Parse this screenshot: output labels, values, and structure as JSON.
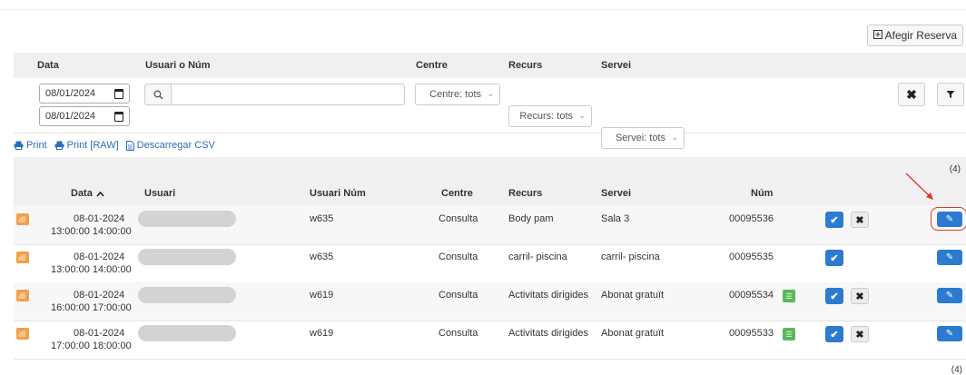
{
  "toolbar": {
    "add_label": "Afegir Reserva"
  },
  "filters": {
    "headers": {
      "data": "Data",
      "user": "Usuari o Núm",
      "centre": "Centre",
      "recurs": "Recurs",
      "servei": "Servei"
    },
    "date_from": "08/01/2024",
    "date_to": "08/01/2024",
    "search_value": "",
    "centre_select": "Centre: tots",
    "recurs_select": "Recurs: tots",
    "servei_select": "Servei: tots"
  },
  "export_links": {
    "print": "Print",
    "print_raw": "Print [RAW]",
    "csv": "Descarregar CSV"
  },
  "count_label": "(4)",
  "table": {
    "columns": {
      "data": "Data",
      "usuari": "Usuari",
      "usuari_num": "Usuari Núm",
      "centre": "Centre",
      "recurs": "Recurs",
      "servei": "Servei",
      "num": "Núm"
    },
    "sort_indicator": "chevron-up-icon",
    "rows": [
      {
        "date": "08-01-2024",
        "time": "13:00:00 14:00:00",
        "usuari_num": "w635",
        "centre": "Consulta",
        "recurs": "Body pam",
        "servei": "Sala 3",
        "num": "00095536",
        "badge": false,
        "reject": true
      },
      {
        "date": "08-01-2024",
        "time": "13:00:00 14:00:00",
        "usuari_num": "w635",
        "centre": "Consulta",
        "recurs": "carril- piscina",
        "servei": "carril- piscina",
        "num": "00095535",
        "badge": false,
        "reject": false
      },
      {
        "date": "08-01-2024",
        "time": "16:00:00 17:00:00",
        "usuari_num": "w619",
        "centre": "Consulta",
        "recurs": "Activitats dirigides",
        "servei": "Abonat gratuït",
        "num": "00095534",
        "badge": true,
        "reject": true
      },
      {
        "date": "08-01-2024",
        "time": "17:00:00 18:00:00",
        "usuari_num": "w619",
        "centre": "Consulta",
        "recurs": "Activitats dirigides",
        "servei": "Abonat gratuït",
        "num": "00095533",
        "badge": true,
        "reject": true
      }
    ]
  },
  "footer_count": "(4)",
  "colors": {
    "primary": "#2b7bd0",
    "accent_orange": "#f0a04e",
    "success": "#5cb85c",
    "annotation_red": "#e0352b"
  }
}
